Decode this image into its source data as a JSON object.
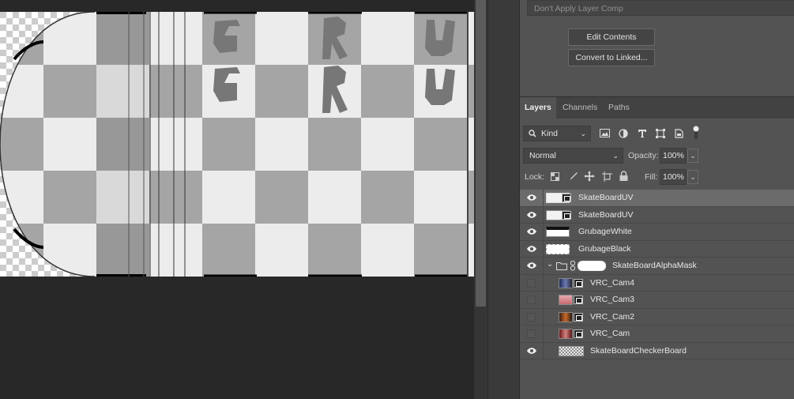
{
  "panel": {
    "layer_comp_placeholder": "Don't Apply Layer Comp",
    "edit_contents_label": "Edit Contents",
    "convert_linked_label": "Convert to Linked..."
  },
  "tabs": [
    {
      "label": "Layers",
      "active": true
    },
    {
      "label": "Channels",
      "active": false
    },
    {
      "label": "Paths",
      "active": false
    }
  ],
  "filter": {
    "kind_label": "Kind"
  },
  "blend": {
    "mode": "Normal",
    "opacity_label": "Opacity:",
    "opacity_value": "100%"
  },
  "lock": {
    "lock_label": "Lock:",
    "fill_label": "Fill:",
    "fill_value": "100%"
  },
  "layers": [
    {
      "name": "SkateBoardUV",
      "visible": true,
      "selected": true,
      "thumb": "smart-white"
    },
    {
      "name": "SkateBoardUV",
      "visible": true,
      "selected": false,
      "thumb": "smart-white"
    },
    {
      "name": "GrubageWhite",
      "visible": true,
      "selected": false,
      "thumb": "white-bar"
    },
    {
      "name": "GrubageBlack",
      "visible": true,
      "selected": false,
      "thumb": "white-dots"
    },
    {
      "name": "SkateBoardAlphaMask",
      "visible": true,
      "selected": false,
      "thumb": "group"
    },
    {
      "name": "VRC_Cam4",
      "visible": false,
      "selected": false,
      "thumb": "cam-blue"
    },
    {
      "name": "VRC_Cam3",
      "visible": false,
      "selected": false,
      "thumb": "cam-pink"
    },
    {
      "name": "VRC_Cam2",
      "visible": false,
      "selected": false,
      "thumb": "cam-orange"
    },
    {
      "name": "VRC_Cam",
      "visible": false,
      "selected": false,
      "thumb": "cam-red"
    },
    {
      "name": "SkateBoardCheckerBoard",
      "visible": true,
      "selected": false,
      "thumb": "checker"
    }
  ],
  "colors": {
    "panel_bg": "#535353",
    "canvas_bg": "#282828",
    "selected_row": "#6b6b6b"
  }
}
